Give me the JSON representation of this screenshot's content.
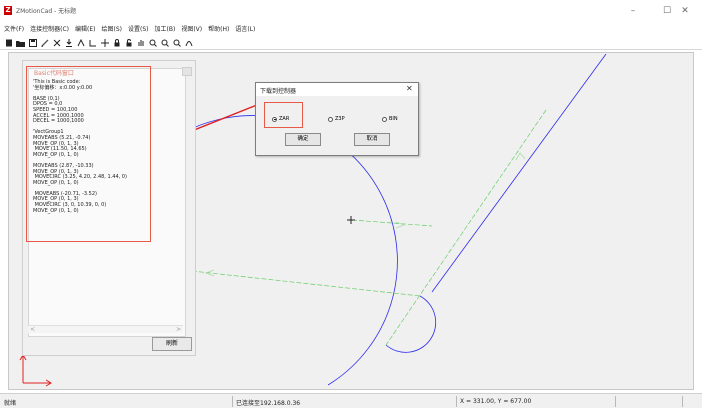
{
  "window": {
    "title": "ZMotionCad - 无标题",
    "logo_letter": "Z",
    "minimize": "–",
    "maximize": "☐",
    "close": "✕"
  },
  "menu": [
    "文件(F)",
    "连接控制器(C)",
    "编辑(E)",
    "绘图(S)",
    "设置(S)",
    "加工(B)",
    "视图(V)",
    "帮助(H)",
    "语言(L)"
  ],
  "toolbar": {
    "icons": [
      "new-file-icon",
      "open-folder-icon",
      "save-icon",
      "pencil-icon",
      "scissors-icon",
      "download-icon",
      "draw-tool-icon",
      "line-tool-icon",
      "crosshair-icon",
      "lock-icon",
      "unlock-icon",
      "hand-pan-icon",
      "zoom-in-icon",
      "zoom-out-icon",
      "zoom-fit-icon",
      "arc-tool-icon"
    ]
  },
  "code_panel": {
    "title": "Basic代码窗口",
    "lines": [
      "'This is Basic code:",
      "'坐标偏移：x:0.00 y:0.00",
      "",
      "BASE (0,1)",
      "DPOS = 0,0",
      "SPEED = 100,100",
      "ACCEL = 1000,1000",
      "DECEL = 1000,1000",
      "",
      "'VectGroup1",
      "MOVEABS (5.21, -0.74)",
      "MOVE_OP (0, 1, 3)",
      " MOVE (11.50, 14.65)",
      "MOVE_OP (0, 1, 0)",
      "",
      "MOVEABS (2.87, -10.33)",
      "MOVE_OP (0, 1, 3)",
      " MOVECIRC (3.25, 4.20, 2.48, 1.44, 0)",
      "MOVE_OP (0, 1, 0)",
      "",
      " MOVEABS (-20.71, -3.52)",
      "MOVE_OP (0, 1, 3)",
      " MOVECIRC (3, 0, 10.39, 0, 0)",
      "MOVE_OP (0, 1, 0)"
    ],
    "scroll_left": "<",
    "scroll_right": ">",
    "refresh_label": "刷新"
  },
  "dialog": {
    "title": "下载到控制器",
    "close": "✕",
    "options": [
      {
        "label": "ZAR",
        "checked": true
      },
      {
        "label": "Z3P",
        "checked": false
      },
      {
        "label": "BIN",
        "checked": false
      }
    ],
    "ok_label": "确定",
    "cancel_label": "取消"
  },
  "status": {
    "ready": "就绪",
    "connection": "已连接至192.168.0.36",
    "coords": "X = 331.00, Y = 677.00"
  },
  "colors": {
    "path": "#2a2aee",
    "travel": "#66cc66",
    "highlight": "#e85a48",
    "axis": "#e02020"
  }
}
